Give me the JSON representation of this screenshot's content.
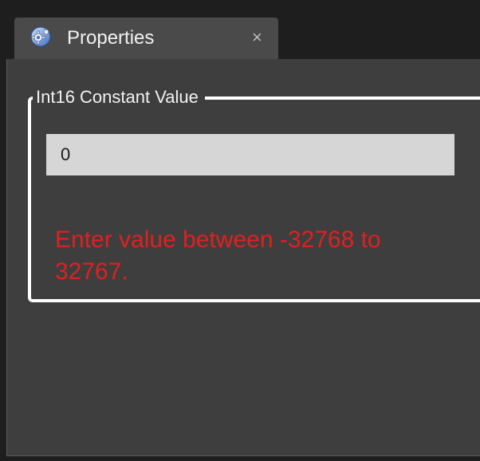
{
  "tab": {
    "icon": "properties-gear-icon",
    "title": "Properties",
    "close_symbol": "×"
  },
  "group": {
    "legend": "Int16 Constant Value"
  },
  "input": {
    "value": "0"
  },
  "validation": {
    "message": "Enter value between -32768 to 32767."
  },
  "colors": {
    "window_bg": "#1e1e1e",
    "tab_bg": "#4a4a4a",
    "panel_bg": "#3e3e3e",
    "input_bg": "#d6d6d6",
    "error": "#e02020",
    "frame": "#ffffff"
  }
}
